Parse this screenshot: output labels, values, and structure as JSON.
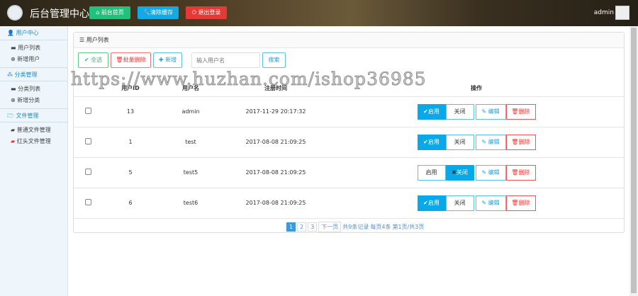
{
  "header": {
    "title": "后台管理中心",
    "buttons": [
      {
        "label": "前台首页",
        "icon": "home-icon",
        "color": "#22c07a"
      },
      {
        "label": "清除缓存",
        "icon": "wrench-icon",
        "color": "#12a9e6"
      },
      {
        "label": "退出登录",
        "icon": "power-icon",
        "color": "#e53935"
      }
    ],
    "user": "admin"
  },
  "sidebar": [
    {
      "title": "用户中心",
      "icon": "user-icon",
      "items": [
        {
          "label": "用户列表",
          "icon": "list-icon"
        },
        {
          "label": "新增用户",
          "icon": "plus-circle-icon"
        }
      ]
    },
    {
      "title": "分类管理",
      "icon": "cubes-icon",
      "items": [
        {
          "label": "分类列表",
          "icon": "list-icon"
        },
        {
          "label": "新增分类",
          "icon": "plus-circle-icon"
        }
      ]
    },
    {
      "title": "文件管理",
      "icon": "folder-icon",
      "items": [
        {
          "label": "普通文件管理",
          "icon": "folder-icon"
        },
        {
          "label": "红头文件管理",
          "icon": "folder-red-icon"
        }
      ]
    }
  ],
  "panel": {
    "title": "用户列表",
    "toolbar": {
      "select_all": "全选",
      "batch_delete": "批量删除",
      "add": "新增",
      "search_placeholder": "输入用户名",
      "search": "搜索"
    },
    "columns": [
      "用户ID",
      "用户名",
      "注册时间",
      "操作"
    ],
    "rows": [
      {
        "id": "13",
        "name": "admin",
        "time": "2017-11-29 20:17:32",
        "enabled": true
      },
      {
        "id": "1",
        "name": "test",
        "time": "2017-08-08 21:09:25",
        "enabled": true
      },
      {
        "id": "5",
        "name": "test5",
        "time": "2017-08-08 21:09:25",
        "enabled": false
      },
      {
        "id": "6",
        "name": "test6",
        "time": "2017-08-08 21:09:25",
        "enabled": true
      }
    ],
    "actions": {
      "enable": "启用",
      "disable": "关闭",
      "edit": "编辑",
      "delete": "删除"
    },
    "pagination": {
      "pages": [
        "1",
        "2",
        "3"
      ],
      "current": "1",
      "next": "下一页",
      "total": "共9条记录",
      "per_page": "每页4条",
      "page_info": "第1页/共3页"
    }
  },
  "watermark": "https://www.huzhan.com/ishop36985"
}
